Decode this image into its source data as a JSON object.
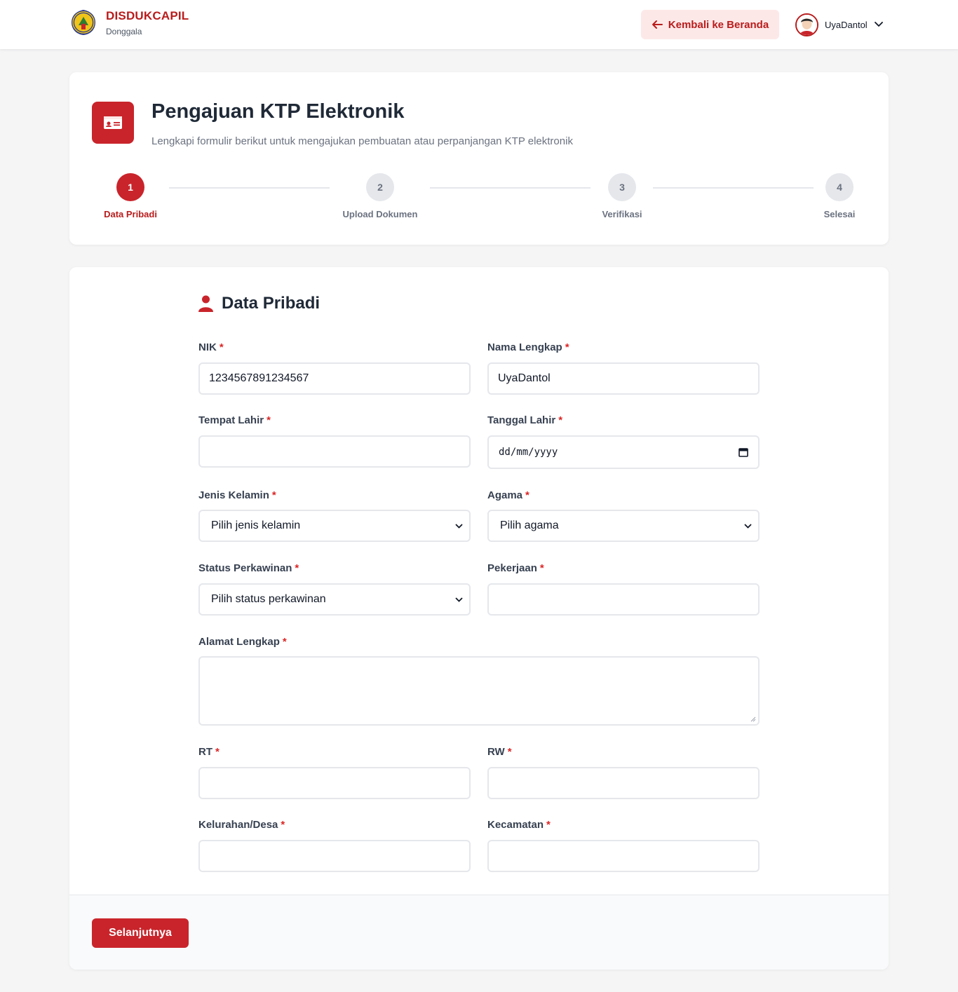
{
  "header": {
    "brand_title": "DISDUKCAPIL",
    "brand_subtitle": "Donggala",
    "back_label": "Kembali ke Beranda",
    "user_name": "UyaDantol"
  },
  "page": {
    "title": "Pengajuan KTP Elektronik",
    "description": "Lengkapi formulir berikut untuk mengajukan pembuatan atau perpanjangan KTP elektronik"
  },
  "steps": [
    {
      "number": "1",
      "label": "Data Pribadi",
      "active": true
    },
    {
      "number": "2",
      "label": "Upload Dokumen",
      "active": false
    },
    {
      "number": "3",
      "label": "Verifikasi",
      "active": false
    },
    {
      "number": "4",
      "label": "Selesai",
      "active": false
    }
  ],
  "form": {
    "section_title": "Data Pribadi",
    "required_mark": "*",
    "nik": {
      "label": "NIK",
      "value": "1234567891234567"
    },
    "nama": {
      "label": "Nama Lengkap",
      "value": "UyaDantol"
    },
    "tempat_lahir": {
      "label": "Tempat Lahir",
      "value": ""
    },
    "tanggal_lahir": {
      "label": "Tanggal Lahir",
      "placeholder": "dd/mm/yyyy"
    },
    "jenis_kelamin": {
      "label": "Jenis Kelamin",
      "selected": "Pilih jenis kelamin"
    },
    "agama": {
      "label": "Agama",
      "selected": "Pilih agama"
    },
    "status_perkawinan": {
      "label": "Status Perkawinan",
      "selected": "Pilih status perkawinan"
    },
    "pekerjaan": {
      "label": "Pekerjaan",
      "value": ""
    },
    "alamat": {
      "label": "Alamat Lengkap",
      "value": ""
    },
    "rt": {
      "label": "RT",
      "value": ""
    },
    "rw": {
      "label": "RW",
      "value": ""
    },
    "kelurahan": {
      "label": "Kelurahan/Desa",
      "value": ""
    },
    "kecamatan": {
      "label": "Kecamatan",
      "value": ""
    }
  },
  "footer": {
    "next_label": "Selanjutnya"
  },
  "colors": {
    "accent": "#c9242b",
    "accent_light": "#fde8e8",
    "border": "#e5e7eb"
  }
}
